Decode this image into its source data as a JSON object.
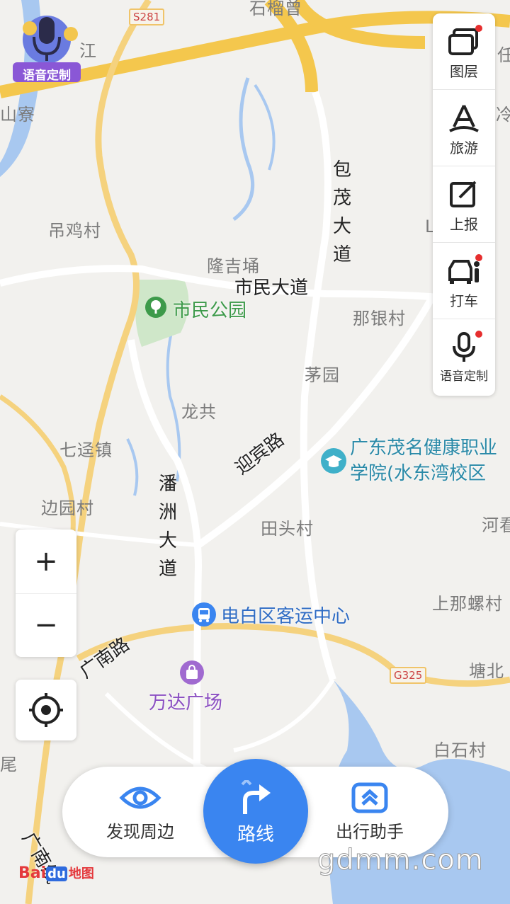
{
  "map": {
    "place_labels": [
      {
        "text": "石榴曾"
      },
      {
        "text": "江"
      },
      {
        "text": "山寮"
      },
      {
        "text": "吊鸡村"
      },
      {
        "text": "隆吉埇"
      },
      {
        "text": "那银村"
      },
      {
        "text": "茅园"
      },
      {
        "text": "龙共"
      },
      {
        "text": "七迳镇"
      },
      {
        "text": "边园村"
      },
      {
        "text": "田头村"
      },
      {
        "text": "河看"
      },
      {
        "text": "上那螺村"
      },
      {
        "text": "塘北"
      },
      {
        "text": "白石村"
      },
      {
        "text": "尾"
      },
      {
        "text": "任"
      },
      {
        "text": "冷"
      },
      {
        "text": "L"
      }
    ],
    "roads": {
      "baomao": "包茂大道",
      "shimin": "市民大道",
      "yingbin": "迎宾路",
      "panzhou": "潘洲大道",
      "guangnan": "广南路",
      "guangnan2": "广南线"
    },
    "shields": {
      "s281": "S281",
      "g325": "G325"
    },
    "pois": {
      "park": "市民公园",
      "college": "广东茂名健康职业学院(水东湾校区",
      "college_line1": "广东茂名健康职业",
      "college_line2": "学院(水东湾校区",
      "bus": "电白区客运中心",
      "mall": "万达广场"
    }
  },
  "right_panel": [
    {
      "label": "图层",
      "icon": "layers-icon",
      "badge": true
    },
    {
      "label": "旅游",
      "icon": "travel-icon",
      "badge": false
    },
    {
      "label": "上报",
      "icon": "report-icon",
      "badge": false
    },
    {
      "label": "打车",
      "icon": "taxi-icon",
      "badge": true
    },
    {
      "label": "语音定制",
      "icon": "microphone-icon",
      "badge": true
    }
  ],
  "voice_badge": "语音定制",
  "zoom": {
    "in": "+",
    "out": "−"
  },
  "bottom_bar": {
    "discover": "发现周边",
    "route": "路线",
    "assistant": "出行助手"
  },
  "brand": {
    "bai": "Bai",
    "du": "du",
    "ditu": "地图"
  },
  "watermark": "gdmm.com",
  "colors": {
    "accent": "#3a85f0",
    "badge": "#e62e2e",
    "park": "#3d9a4a",
    "mall": "#8b4fc2"
  }
}
